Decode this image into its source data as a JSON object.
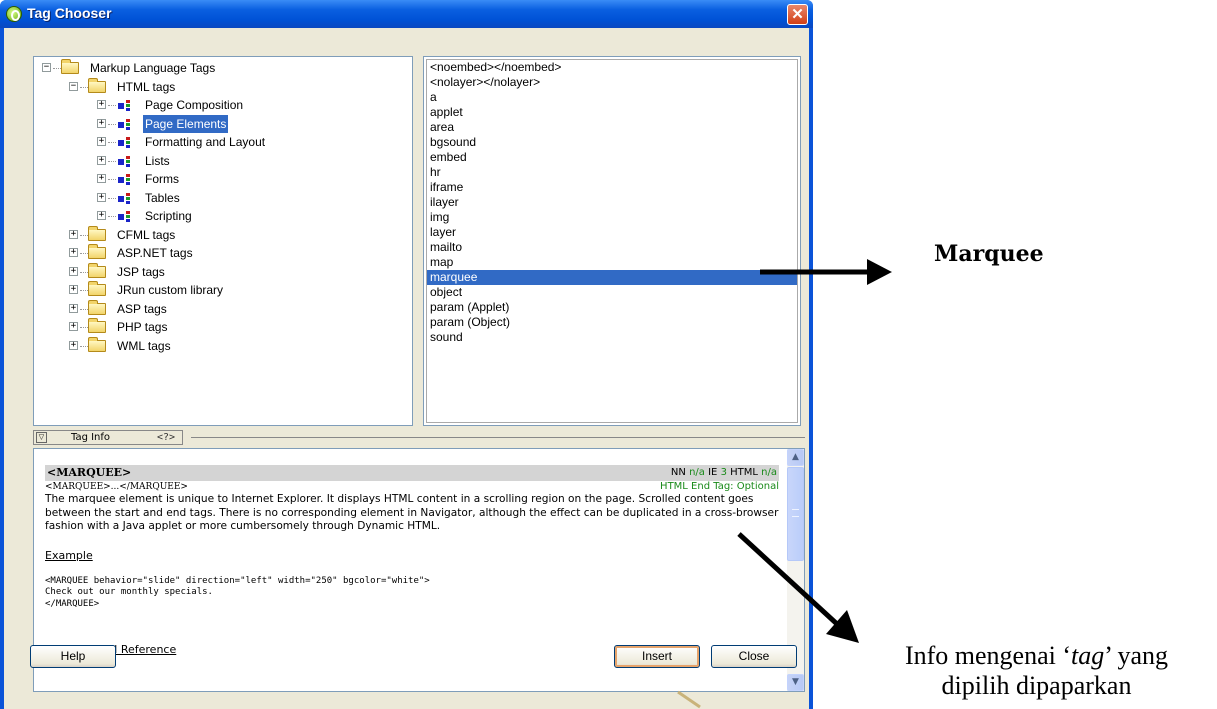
{
  "window": {
    "title": "Tag Chooser",
    "close_glyph": "✕"
  },
  "tree": {
    "root": "Markup Language Tags",
    "html": "HTML tags",
    "html_children": [
      "Page Composition",
      "Page Elements",
      "Formatting and Layout",
      "Lists",
      "Forms",
      "Tables",
      "Scripting"
    ],
    "selected_child": "Page Elements",
    "libraries": [
      "CFML tags",
      "ASP.NET tags",
      "JSP tags",
      "JRun custom library",
      "ASP tags",
      "PHP tags",
      "WML tags"
    ],
    "expand_glyph": "+",
    "collapse_glyph": "−"
  },
  "tag_list": {
    "items": [
      "<noembed></noembed>",
      "<nolayer></nolayer>",
      "a",
      "applet",
      "area",
      "bgsound",
      "embed",
      "hr",
      "iframe",
      "ilayer",
      "img",
      "layer",
      "mailto",
      "map",
      "marquee",
      "object",
      "param (Applet)",
      "param (Object)",
      "sound"
    ],
    "selected": "marquee"
  },
  "tag_info": {
    "tab_label": "Tag Info",
    "glyph": "<?>",
    "collapse_glyph": "▽",
    "heading": "<MARQUEE>",
    "compat_nn": "NN",
    "compat_nn_val": "n/a",
    "compat_ie": "IE",
    "compat_ie_val": "3",
    "compat_html": "HTML",
    "compat_html_val": "n/a",
    "syntax": "<MARQUEE>...</MARQUEE>",
    "end_tag": "HTML End Tag: Optional",
    "description": "The marquee element is unique to Internet Explorer. It displays HTML content in a scrolling region on the page. Scrolled content goes between the start and end tags. There is no corresponding element in Navigator, although the effect can be duplicated in a cross-browser fashion with a Java applet or more cumbersomely through Dynamic HTML.",
    "example_label": "Example",
    "example_code": "<MARQUEE behavior=\"slide\" direction=\"left\" width=\"250\" bgcolor=\"white\">\nCheck out our monthly specials.\n</MARQUEE>",
    "object_model_label": "Object Model Reference"
  },
  "scrollbar": {
    "up_glyph": "▲",
    "down_glyph": "▼"
  },
  "buttons": {
    "help": "Help",
    "insert": "Insert",
    "close": "Close"
  },
  "annotations": {
    "marquee_label": "Marquee",
    "info_line1": "Info mengenai ‘",
    "info_tag_word": "tag",
    "info_line1_end": "’ yang",
    "info_line2": "dipilih dipaparkan"
  },
  "colors": {
    "titlebar": "#0a5fe0",
    "selection": "#316ac5",
    "dialog_face": "#ece9d8",
    "compat_green": "#1a8a1a"
  },
  "icons": [
    "app-logo-icon",
    "close-icon",
    "folder-icon",
    "tag-category-icon",
    "expander-icon",
    "scroll-up-icon",
    "scroll-down-icon"
  ]
}
